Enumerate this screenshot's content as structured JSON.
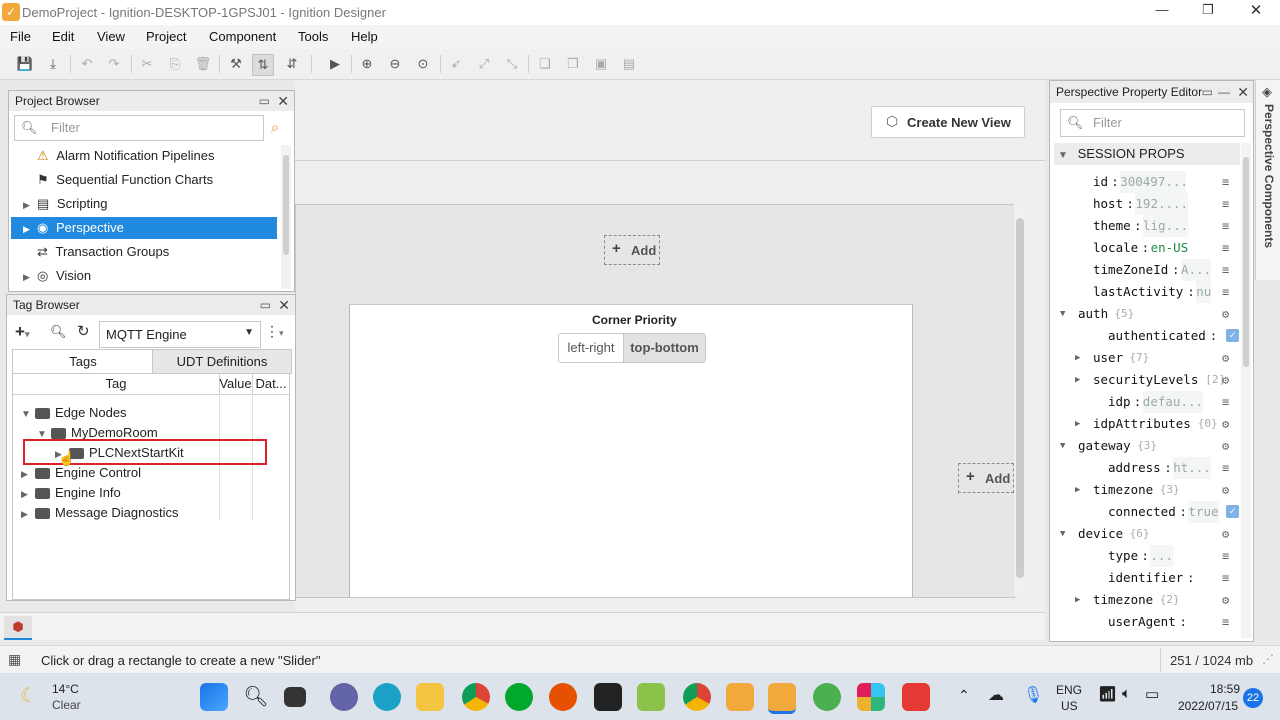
{
  "window": {
    "title": "DemoProject - Ignition-DESKTOP-1GPSJ01 - Ignition Designer"
  },
  "menu": [
    "File",
    "Edit",
    "View",
    "Project",
    "Component",
    "Tools",
    "Help"
  ],
  "project_browser": {
    "title": "Project Browser",
    "filter_placeholder": "Filter",
    "items": [
      {
        "label": "Alarm Notification Pipelines",
        "expandable": false,
        "selected": false
      },
      {
        "label": "Sequential Function Charts",
        "expandable": false,
        "selected": false
      },
      {
        "label": "Scripting",
        "expandable": true,
        "selected": false
      },
      {
        "label": "Perspective",
        "expandable": true,
        "selected": true
      },
      {
        "label": "Transaction Groups",
        "expandable": false,
        "selected": false
      },
      {
        "label": "Vision",
        "expandable": true,
        "selected": false
      }
    ]
  },
  "tag_browser": {
    "title": "Tag Browser",
    "provider": "MQTT Engine",
    "tabs": [
      "Tags",
      "UDT Definitions"
    ],
    "columns": [
      "Tag",
      "Value",
      "Dat..."
    ],
    "rows": [
      {
        "label": "Edge Nodes",
        "expanded": true
      },
      {
        "label": "MyDemoRoom",
        "expanded": true
      },
      {
        "label": "PLCNextStartKit",
        "expanded": false
      },
      {
        "label": "Engine Control",
        "expanded": false
      },
      {
        "label": "Engine Info",
        "expanded": false
      },
      {
        "label": "Message Diagnostics",
        "expanded": false
      }
    ]
  },
  "canvas": {
    "create_view_label": "Create New View",
    "add_label": "Add",
    "corner_priority_title": "Corner Priority",
    "corner_options": [
      "left-right",
      "top-bottom"
    ],
    "corner_selected": "top-bottom"
  },
  "property_editor": {
    "title": "Perspective Property Editor",
    "filter_placeholder": "Filter",
    "section": "SESSION PROPS",
    "side_tab": "Perspective Components",
    "rows": [
      {
        "key": "id",
        "value": "300497...",
        "indent": 1
      },
      {
        "key": "host",
        "value": "192....",
        "indent": 1
      },
      {
        "key": "theme",
        "value": "lig...",
        "indent": 1
      },
      {
        "key": "locale",
        "value": "en-US",
        "indent": 1
      },
      {
        "key": "timeZoneId",
        "value": "A...",
        "indent": 1
      },
      {
        "key": "lastActivity",
        "value": "nu",
        "indent": 1
      },
      {
        "key": "auth",
        "count": "{5}",
        "indent": 0,
        "expanded": true
      },
      {
        "key": "authenticated",
        "value": "",
        "indent": 2,
        "checkbox": true
      },
      {
        "key": "user",
        "count": "{7}",
        "indent": 1,
        "expandable": true
      },
      {
        "key": "securityLevels",
        "count": "[2]",
        "indent": 1,
        "expandable": true
      },
      {
        "key": "idp",
        "value": "defau...",
        "indent": 2
      },
      {
        "key": "idpAttributes",
        "count": "{0}",
        "indent": 1,
        "expandable": true
      },
      {
        "key": "gateway",
        "count": "{3}",
        "indent": 0,
        "expanded": true
      },
      {
        "key": "address",
        "value": "ht...",
        "indent": 2
      },
      {
        "key": "timezone",
        "count": "{3}",
        "indent": 1,
        "expandable": true
      },
      {
        "key": "connected",
        "value": "true",
        "indent": 2,
        "checkbox": true
      },
      {
        "key": "device",
        "count": "{6}",
        "indent": 0,
        "expanded": true
      },
      {
        "key": "type",
        "value": "...",
        "indent": 2
      },
      {
        "key": "identifier",
        "value": "",
        "indent": 2
      },
      {
        "key": "timezone",
        "count": "{2}",
        "indent": 1,
        "expandable": true
      },
      {
        "key": "userAgent",
        "value": "",
        "indent": 2
      }
    ]
  },
  "status_bar": {
    "message": "Click or drag a rectangle to create a new \"Slider\"",
    "memory": "251 / 1024 mb"
  },
  "taskbar": {
    "weather_temp": "14°C",
    "weather_desc": "Clear",
    "lang_top": "ENG",
    "lang_bottom": "US",
    "time": "18:59",
    "date": "2022/07/15",
    "notifications": "22"
  },
  "colors": {
    "selection": "#1f8ae0",
    "highlight_box": "#e0202a",
    "accent": "#f2a93b"
  }
}
